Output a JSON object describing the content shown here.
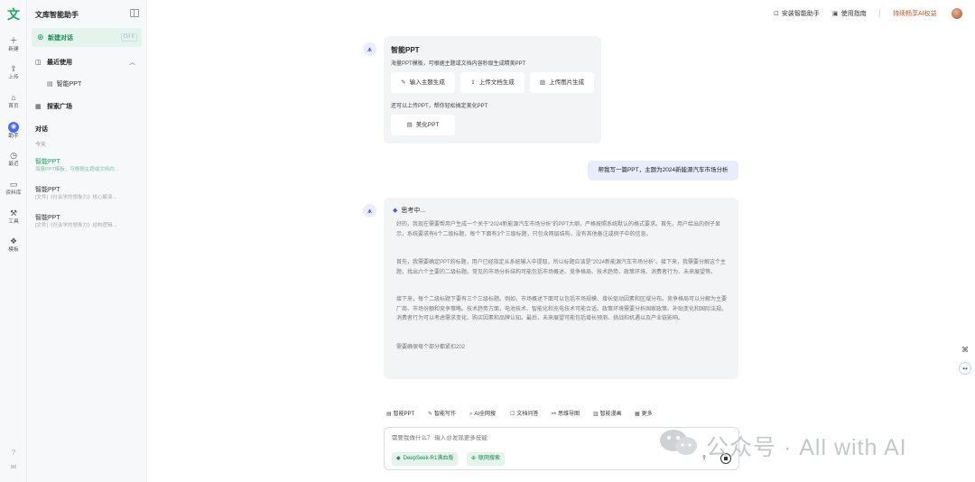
{
  "app": {
    "logo_char": "文",
    "title": "文库智能助手"
  },
  "rail": [
    {
      "icon": "＋",
      "label": "新建"
    },
    {
      "icon": "⇪",
      "label": "上传"
    },
    {
      "icon": "⌂",
      "label": "首页"
    },
    {
      "icon": "◉",
      "label": "助手"
    },
    {
      "icon": "◷",
      "label": "最近"
    },
    {
      "icon": "▭",
      "label": "资料库"
    },
    {
      "icon": "⚒",
      "label": "工具"
    },
    {
      "icon": "❖",
      "label": "模板"
    }
  ],
  "sidebar": {
    "new_chat": "新建对话",
    "new_chat_shortcut": "Ctrl K",
    "recent": "最近使用",
    "recent_item": "智能PPT",
    "explore": "探索广场",
    "conversations_title": "对话",
    "today": "今天",
    "conversations": [
      {
        "title": "智能PPT",
        "desc": "海量PPT模板，可根据主题或文档内..."
      },
      {
        "title": "智能PPT",
        "desc": "[文件]《社会学的想象力》核心解读..."
      },
      {
        "title": "智能PPT",
        "desc": "[文件]《社会学的想象力》结构逻辑..."
      }
    ]
  },
  "topbar": {
    "install": "安装智能助手",
    "guide": "使用指南",
    "promo": "持续畅享AI权益"
  },
  "ppt_card": {
    "title": "智能PPT",
    "desc": "海量PPT模板，可根据主题或文档内容秒级生成精美PPT",
    "options": [
      "输入主题生成",
      "上传文档生成",
      "上传图片生成"
    ],
    "also": "还可以上传PPT，帮你轻松搞定美化PPT",
    "beautify": "美化PPT"
  },
  "user_message": "帮我写一篇PPT，主题为2024新能源汽车市场分析",
  "reply": {
    "thinking": "思考中...",
    "paragraphs": [
      "好的，我现在需要帮用户生成一个关于“2024新能源汽车市场分析”的PPT大纲，严格按照系统默认的格式要求。首先，用户给出的例子显示，系统要求有6个二级标题，每个下面有3个三级标题，只包含两层结构，没有其他备注或例子中的信息。",
      "首先，我需要确定PPT的标题，用户已经指定从系统输入中提取，所以标题应该是“2024新能源汽车市场分析”。接下来，我需要分解这个主题，找出六个主要的二级标题。常见的市场分析结构可能包括市场概述、竞争格局、技术趋势、政策环境、消费者行为、未来展望等。",
      "接下来，每个二级标题下要有三个三级标题。例如，市场概述下面可以包括市场规模、增长驱动因素和区域分布。竞争格局可以分解为主要厂商、市场份额和竞争策略。技术趋势方面，电池技术、智能化和充电技术可能合适。政策环境需要分析国家政策、补贴变化和国际法规。消费者行为可以考虑需求变化、购买因素和品牌认知。最后，未来展望可能包括增长预测、挑战和机遇以及产业链影响。",
      "需要确保每个部分都紧扣202"
    ]
  },
  "tools": [
    "智能PPT",
    "智能写作",
    "AI全网搜",
    "文档问答",
    "思维导图",
    "智能漫画",
    "更多"
  ],
  "input": {
    "placeholder": "需要我做什么？ 输入@发现更多技能",
    "chip_deepseek": "DeepSeek-R1满血版",
    "chip_search": "联网搜索"
  },
  "watermark": "公众号 · All with AI"
}
